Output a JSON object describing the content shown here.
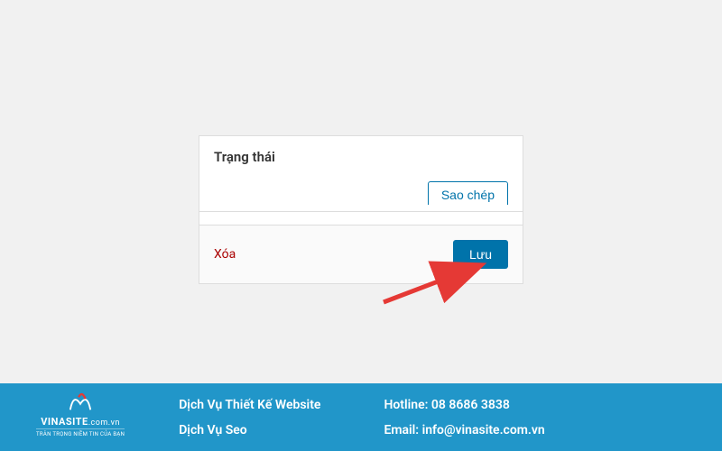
{
  "panel": {
    "title": "Trạng thái",
    "copy_button": "Sao chép",
    "delete_link": "Xóa",
    "save_button": "Lưu"
  },
  "footer": {
    "logo_name": "VINASITE",
    "logo_domain": ".com.vn",
    "logo_tagline": "TRÂN TRỌNG NIỀM TIN CỦA BẠN",
    "services": {
      "web_design": "Dịch Vụ Thiết Kế Website",
      "seo": "Dịch Vụ Seo"
    },
    "contact": {
      "hotline_label": "Hotline:",
      "hotline_value": "08 8686 3838",
      "email_label": "Email:",
      "email_value": "info@vinasite.com.vn"
    }
  }
}
